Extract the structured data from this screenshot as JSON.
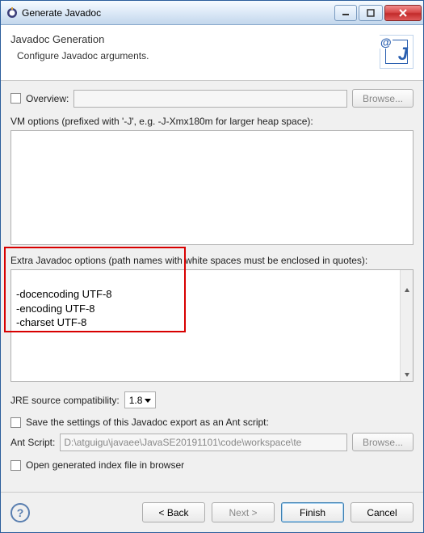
{
  "window": {
    "title": "Generate Javadoc"
  },
  "header": {
    "title": "Javadoc Generation",
    "subtitle": "Configure Javadoc arguments."
  },
  "overview": {
    "label": "Overview:",
    "value": "",
    "browse": "Browse..."
  },
  "vm_options": {
    "label": "VM options (prefixed with '-J', e.g. -J-Xmx180m for larger heap space):",
    "value": ""
  },
  "extra_options": {
    "label": "Extra Javadoc options (path names with white spaces must be enclosed in quotes):",
    "value": "-docencoding UTF-8\n-encoding UTF-8\n-charset UTF-8"
  },
  "jre": {
    "label": "JRE source compatibility:",
    "value": "1.8"
  },
  "save_ant": {
    "label": "Save the settings of this Javadoc export as an Ant script:"
  },
  "ant_script": {
    "label": "Ant Script:",
    "value": "D:\\atguigu\\javaee\\JavaSE20191101\\code\\workspace\\te",
    "browse": "Browse..."
  },
  "open_index": {
    "label": "Open generated index file in browser"
  },
  "buttons": {
    "back": "< Back",
    "next": "Next >",
    "finish": "Finish",
    "cancel": "Cancel"
  }
}
